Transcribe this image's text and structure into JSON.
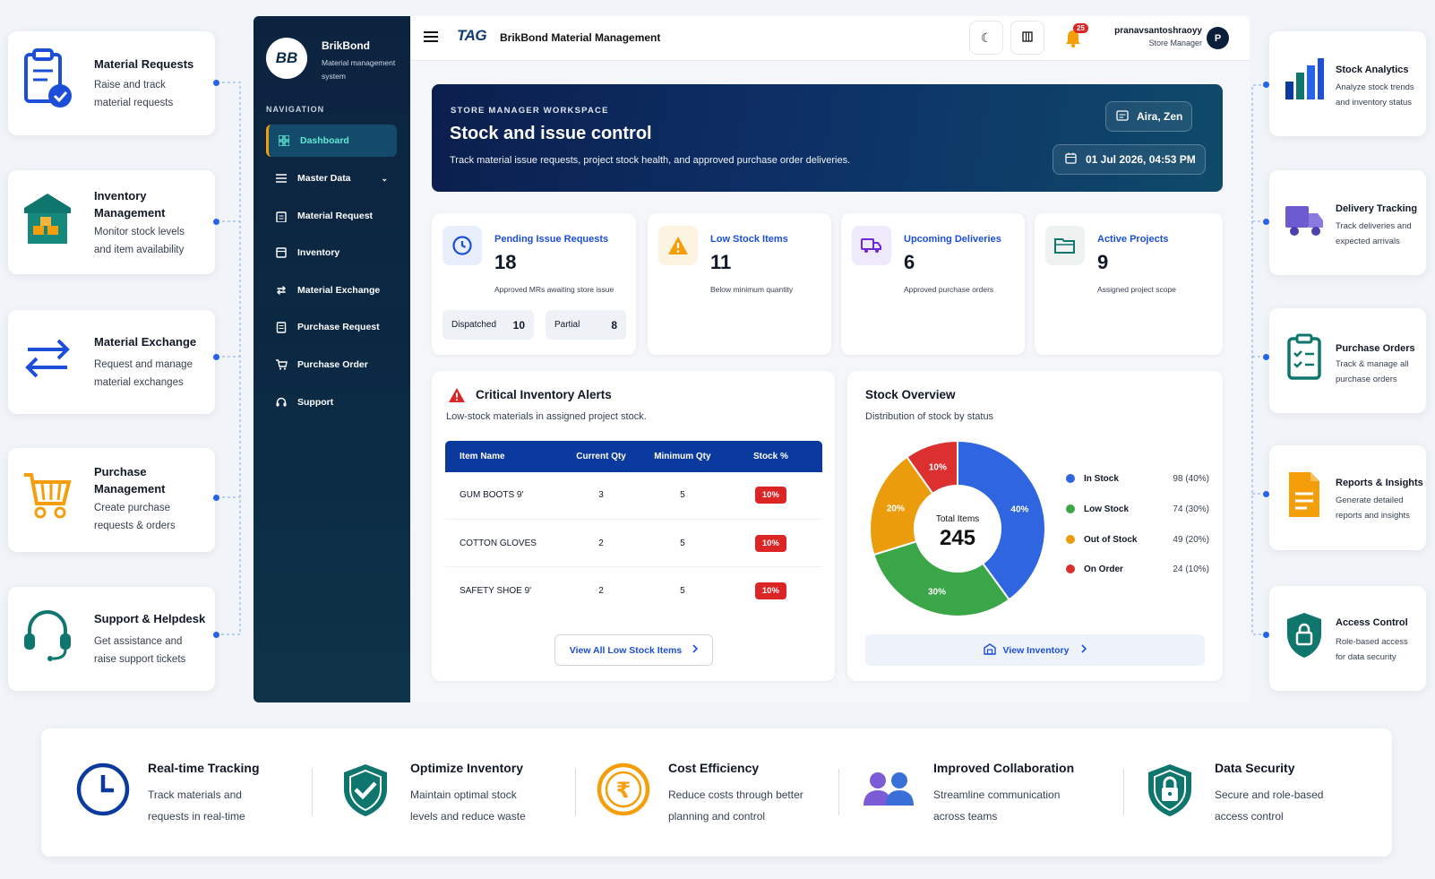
{
  "left_features": [
    {
      "title": "Material Requests",
      "desc_lines": [
        "Raise and track",
        "material requests"
      ],
      "icon": "clipboard-check-icon"
    },
    {
      "title_lines": [
        "Inventory",
        "Management"
      ],
      "desc_lines": [
        "Monitor stock levels",
        "and item availability"
      ],
      "icon": "warehouse-icon"
    },
    {
      "title": "Material Exchange",
      "desc_lines": [
        "Request and manage",
        "material exchanges"
      ],
      "icon": "exchange-arrows-icon"
    },
    {
      "title_lines": [
        "Purchase",
        "Management"
      ],
      "desc_lines": [
        "Create purchase",
        "requests & orders"
      ],
      "icon": "cart-icon"
    },
    {
      "title": "Support & Helpdesk",
      "desc_lines": [
        "Get assistance and",
        "raise support tickets"
      ],
      "icon": "headset-icon"
    }
  ],
  "right_features": [
    {
      "title": "Stock Analytics",
      "desc_lines": [
        "Analyze stock trends",
        "and inventory status"
      ],
      "icon": "bar-chart-icon"
    },
    {
      "title": "Delivery Tracking",
      "desc_lines": [
        "Track deliveries and",
        "expected arrivals"
      ],
      "icon": "truck-icon"
    },
    {
      "title": "Purchase Orders",
      "desc_lines": [
        "Track & manage all",
        "purchase orders"
      ],
      "icon": "checklist-icon"
    },
    {
      "title": "Reports & Insights",
      "desc_lines": [
        "Generate detailed",
        "reports and insights"
      ],
      "icon": "document-icon"
    },
    {
      "title": "Access Control",
      "desc_lines": [
        "Role-based access",
        "for data security"
      ],
      "icon": "shield-lock-icon"
    }
  ],
  "sidebar": {
    "logo_text": "BB",
    "brand": "BrikBond",
    "brand_sub_lines": [
      "Material management",
      "system"
    ],
    "nav_heading": "NAVIGATION",
    "items": [
      {
        "label": "Dashboard",
        "icon": "grid-icon",
        "active": true
      },
      {
        "label": "Master Data",
        "icon": "list-icon",
        "has_chevron": true
      },
      {
        "label": "Material Request",
        "icon": "clipboard-icon"
      },
      {
        "label": "Inventory",
        "icon": "box-icon"
      },
      {
        "label": "Material Exchange",
        "icon": "exchange-icon"
      },
      {
        "label": "Purchase Request",
        "icon": "receipt-icon"
      },
      {
        "label": "Purchase Order",
        "icon": "cart-icon"
      },
      {
        "label": "Support",
        "icon": "headset-icon"
      }
    ]
  },
  "topbar": {
    "logo": "TAG",
    "title": "BrikBond Material Management",
    "notification_count": "25",
    "user_name": "pranavsantoshraoyy",
    "user_role": "Store Manager",
    "avatar_letter": "P"
  },
  "hero": {
    "eyebrow": "STORE MANAGER WORKSPACE",
    "title": "Stock and issue control",
    "subtitle": "Track material issue requests, project stock health, and approved purchase order deliveries.",
    "user_pill": "Aira, Zen",
    "date_pill": "01 Jul 2026, 04:53 PM"
  },
  "stats": [
    {
      "label": "Pending Issue Requests",
      "value": "18",
      "sub": "Approved MRs awaiting store issue",
      "color": "#1d4ed8",
      "chips": [
        {
          "label": "Dispatched",
          "value": "10"
        },
        {
          "label": "Partial",
          "value": "8"
        }
      ]
    },
    {
      "label": "Low Stock Items",
      "value": "11",
      "sub": "Below minimum quantity",
      "color": "#f59e0b"
    },
    {
      "label": "Upcoming Deliveries",
      "value": "6",
      "sub": "Approved purchase orders",
      "color": "#6d28d9"
    },
    {
      "label": "Active Projects",
      "value": "9",
      "sub": "Assigned project scope",
      "color": "#0f766e"
    }
  ],
  "alerts": {
    "title": "Critical Inventory Alerts",
    "subtitle": "Low-stock materials in assigned project stock.",
    "columns": [
      "Item Name",
      "Current Qty",
      "Minimum Qty",
      "Stock %"
    ],
    "rows": [
      [
        "GUM BOOTS 9'",
        "3",
        "5",
        "10%"
      ],
      [
        "COTTON GLOVES",
        "2",
        "5",
        "10%"
      ],
      [
        "SAFETY SHOE 9'",
        "2",
        "5",
        "10%"
      ]
    ],
    "link": "View All Low Stock Items"
  },
  "stock_overview": {
    "title": "Stock Overview",
    "subtitle": "Distribution of stock by status",
    "center_label": "Total Items",
    "center_value": "245",
    "link": "View Inventory"
  },
  "chart_data": {
    "type": "pie",
    "categories": [
      "In Stock",
      "Low Stock",
      "Out of Stock",
      "On Order"
    ],
    "values": [
      98,
      74,
      49,
      24
    ],
    "value_labels": [
      "98 (40%)",
      "74 (30%)",
      "49 (20%)",
      "24 (10%)"
    ],
    "slice_labels": [
      "40%",
      "30%",
      "20%",
      "10%"
    ],
    "colors": [
      "#2f66e0",
      "#3aa647",
      "#eb9c0c",
      "#dc2f2f"
    ],
    "legend_position": "right"
  },
  "benefits": [
    {
      "title": "Real-time Tracking",
      "desc_lines": [
        "Track materials and",
        "requests in real-time"
      ],
      "icon": "clock-icon"
    },
    {
      "title": "Optimize Inventory",
      "desc_lines": [
        "Maintain optimal stock",
        "levels and reduce waste"
      ],
      "icon": "shield-check-icon"
    },
    {
      "title": "Cost Efficiency",
      "desc_lines": [
        "Reduce costs through better",
        "planning and control"
      ],
      "icon": "rupee-coin-icon"
    },
    {
      "title": "Improved Collaboration",
      "desc_lines": [
        "Streamline communication",
        "across teams"
      ],
      "icon": "people-icon"
    },
    {
      "title": "Data Security",
      "desc_lines": [
        "Secure and role-based",
        "access control"
      ],
      "icon": "shield-lock-icon"
    }
  ]
}
